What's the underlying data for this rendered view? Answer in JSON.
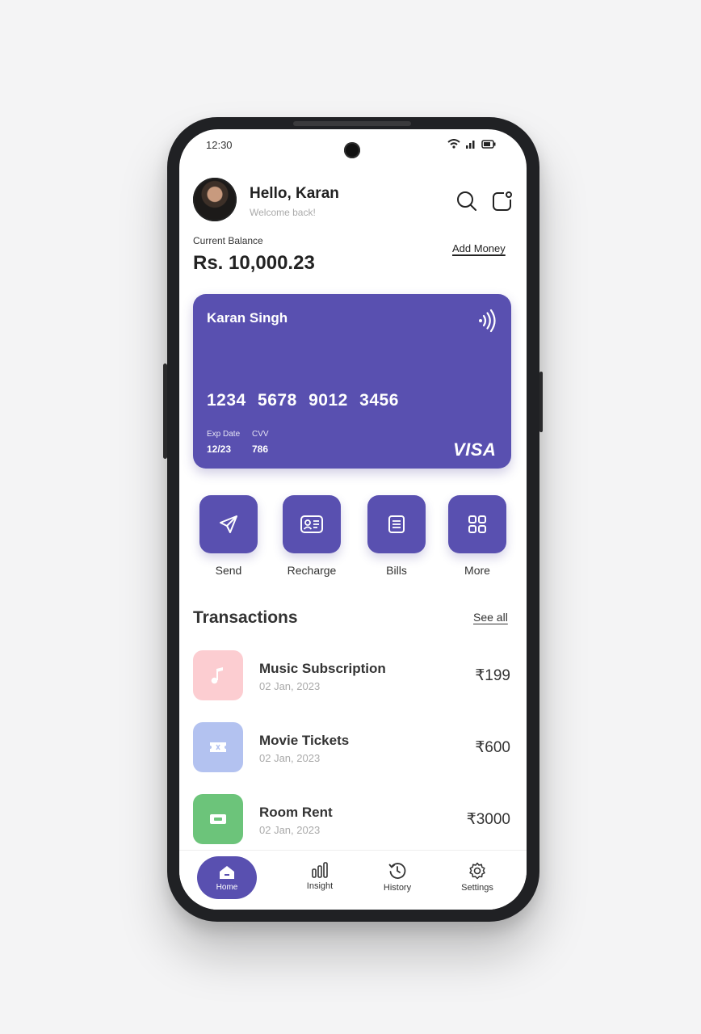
{
  "status": {
    "time": "12:30"
  },
  "header": {
    "greeting": "Hello, Karan",
    "subtitle": "Welcome back!"
  },
  "balance": {
    "label": "Current Balance",
    "value": "Rs. 10,000.23",
    "add_money": "Add Money"
  },
  "card": {
    "holder": "Karan Singh",
    "number": "1234 5678 9012 3456",
    "exp_label": "Exp Date",
    "exp_value": "12/23",
    "cvv_label": "CVV",
    "cvv_value": "786",
    "brand": "VISA",
    "color": "#5950b0"
  },
  "actions": [
    {
      "label": "Send",
      "icon": "send-icon"
    },
    {
      "label": "Recharge",
      "icon": "id-card-icon"
    },
    {
      "label": "Bills",
      "icon": "bill-icon"
    },
    {
      "label": "More",
      "icon": "grid-icon"
    }
  ],
  "transactions": {
    "title": "Transactions",
    "see_all": "See all",
    "items": [
      {
        "title": "Music Subscription",
        "date": "02 Jan, 2023",
        "amount": "₹199",
        "icon": "music-note-icon",
        "color": "#fccdd1"
      },
      {
        "title": "Movie Tickets",
        "date": "02 Jan, 2023",
        "amount": "₹600",
        "icon": "ticket-icon",
        "color": "#b3c2f0"
      },
      {
        "title": "Room Rent",
        "date": "02 Jan, 2023",
        "amount": "₹3000",
        "icon": "cash-icon",
        "color": "#6cc47a"
      }
    ]
  },
  "nav": {
    "items": [
      {
        "label": "Home",
        "icon": "home-icon",
        "active": true
      },
      {
        "label": "Insight",
        "icon": "bar-chart-icon"
      },
      {
        "label": "History",
        "icon": "history-icon"
      },
      {
        "label": "Settings",
        "icon": "gear-icon"
      }
    ]
  }
}
